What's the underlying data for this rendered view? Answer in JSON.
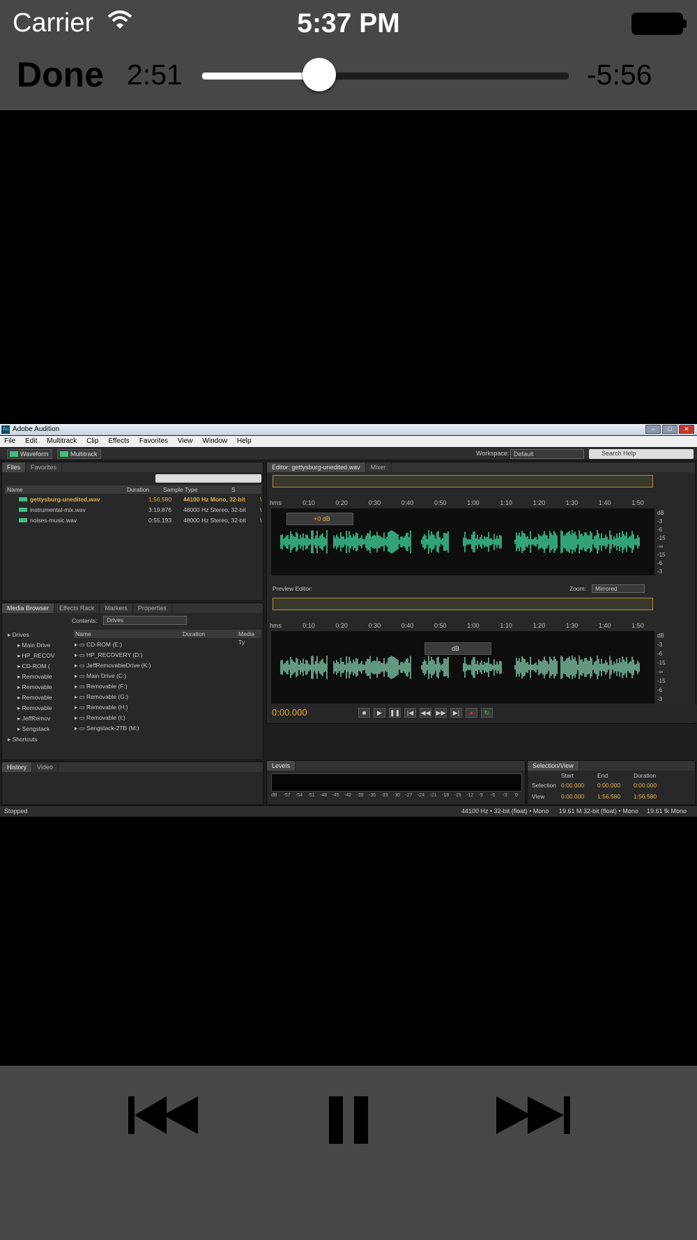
{
  "status_bar": {
    "carrier": "Carrier",
    "time": "5:37 PM"
  },
  "player": {
    "done_label": "Done",
    "elapsed": "2:51",
    "remaining": "-5:56",
    "progress": 0.32
  },
  "video": {
    "window_title": "Adobe Audition",
    "logo_text": "Au",
    "menu": [
      "File",
      "Edit",
      "Multitrack",
      "Clip",
      "Effects",
      "Favorites",
      "View",
      "Window",
      "Help"
    ],
    "toolbar": {
      "waveform": "Waveform",
      "multitrack": "Multitrack",
      "workspace_label": "Workspace:",
      "workspace_value": "Default",
      "search_placeholder": "Search Help"
    },
    "files_panel": {
      "tabs": [
        "Files",
        "Favorites"
      ],
      "columns": [
        "Name",
        "Duration",
        "Sample Type",
        "S"
      ],
      "files": [
        {
          "name": "gettysburg-unedited.wav",
          "duration": "1:56.580",
          "sample_type": "44100 Hz Mono, 32-bit",
          "extra": "\\"
        },
        {
          "name": "instrumental-mix.wav",
          "duration": "3:19.876",
          "sample_type": "48000 Hz Stereo, 32-bit",
          "extra": "\\"
        },
        {
          "name": "noises-music.wav",
          "duration": "0:55.193",
          "sample_type": "48000 Hz Stereo, 32-bit",
          "extra": "\\"
        }
      ]
    },
    "media_browser": {
      "tabs": [
        "Media Browser",
        "Effects Rack",
        "Markers",
        "Properties"
      ],
      "contents_label": "Contents:",
      "contents_value": "Drives",
      "tree": [
        "Drives",
        "Main Drive",
        "HP_RECOV",
        "CD-ROM (",
        "Removable",
        "Removable",
        "Removable",
        "Removable",
        "JeffRemov",
        "Sengstack",
        "Shortcuts"
      ],
      "columns": [
        "Name",
        "Duration",
        "Media Ty"
      ],
      "items": [
        "CD-ROM (E:)",
        "HP_RECOVERY (D:)",
        "JeffRemovableDrive (K:)",
        "Main Drive (C:)",
        "Removable (F:)",
        "Removable (G:)",
        "Removable (H:)",
        "Removable (I:)",
        "Sengstack-2TB (M:)"
      ]
    },
    "editor": {
      "tabs": [
        "Editor: gettysburg-unedited.wav",
        "Mixer"
      ],
      "ruler": [
        "hms",
        "0:10",
        "0:20",
        "0:30",
        "0:40",
        "0:50",
        "1:00",
        "1:10",
        "1:20",
        "1:30",
        "1:40",
        "1:50"
      ],
      "db_scale": [
        "dB",
        "-3",
        "-6",
        "-15",
        "-∞",
        "-15",
        "-6",
        "-3"
      ],
      "gain": "+0 dB",
      "preview_label": "Preview Editor:",
      "zoom_label": "Zoom:",
      "zoom_value": "Mirrored",
      "preview_gain": "dB",
      "timecode": "0:00.000"
    },
    "lower_tabs": {
      "history": "History",
      "video": "Video",
      "levels": "Levels",
      "selection_view": "Selection/View"
    },
    "levels_scale": [
      "dB",
      "-57",
      "-54",
      "-51",
      "-48",
      "-45",
      "-42",
      "-39",
      "-36",
      "-33",
      "-30",
      "-27",
      "-24",
      "-21",
      "-18",
      "-15",
      "-12",
      "-9",
      "-6",
      "-3",
      "0"
    ],
    "selection_view": {
      "headers": [
        "Start",
        "End",
        "Duration"
      ],
      "rows": [
        {
          "label": "Selection",
          "start": "0:00.000",
          "end": "0:00.000",
          "duration": "0:00.000"
        },
        {
          "label": "View",
          "start": "0:00.000",
          "end": "1:56.580",
          "duration": "1:56.580"
        }
      ]
    },
    "status": {
      "state": "Stopped",
      "format": "44100 Hz • 32-bit (float) • Mono",
      "size1": "19.61 M 32-bit (float) • Mono",
      "size2": "19.61 fk Mono"
    }
  }
}
